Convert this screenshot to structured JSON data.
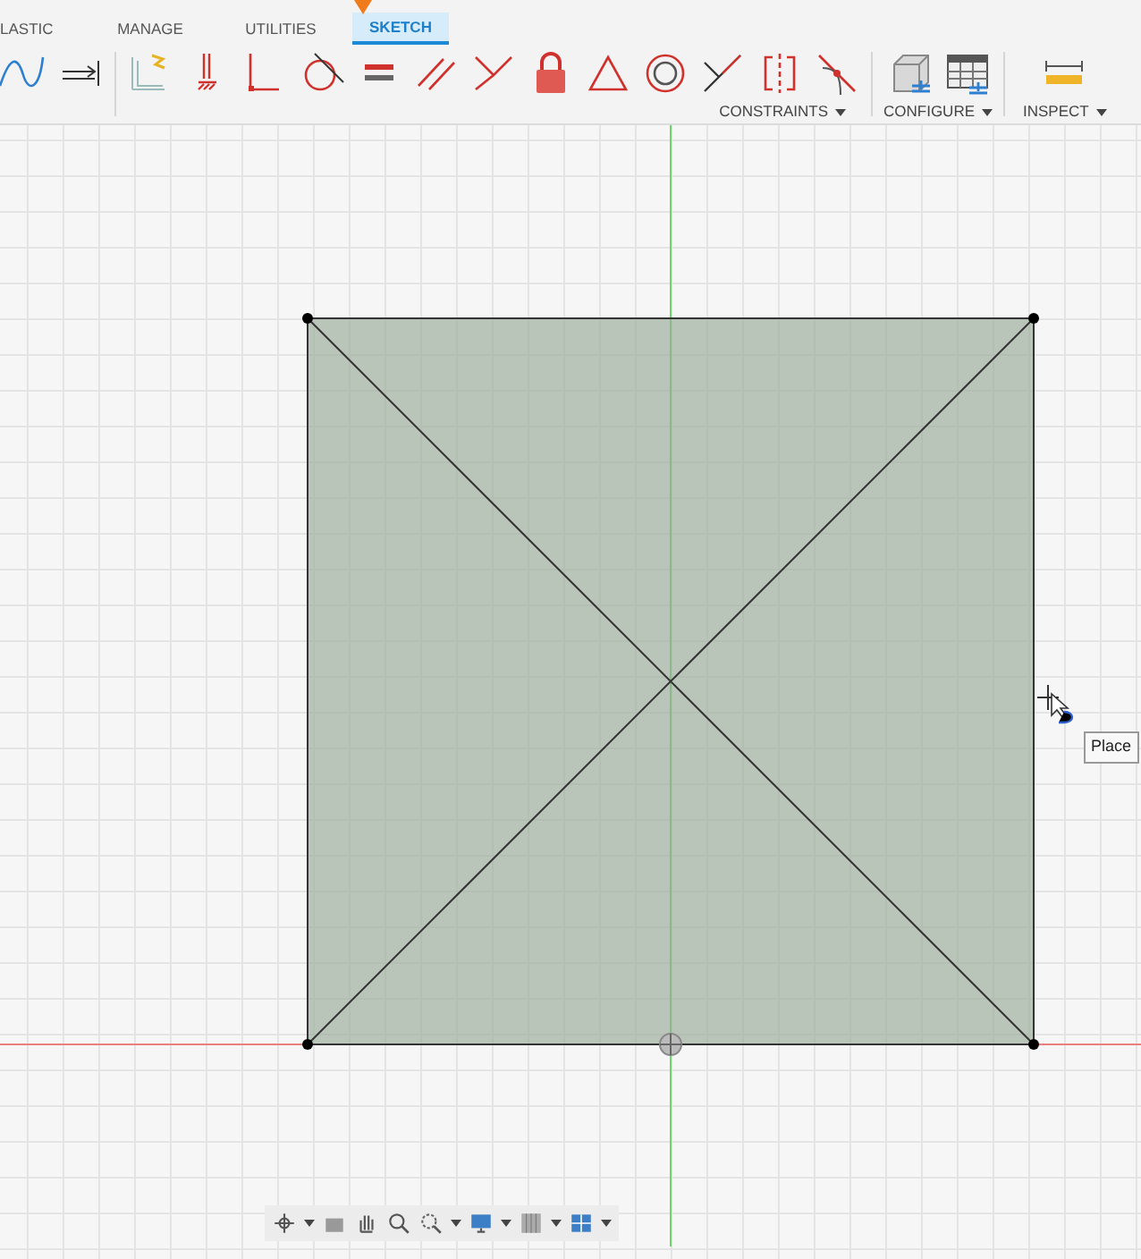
{
  "tabs": [
    {
      "label": "LASTIC",
      "selected": false
    },
    {
      "label": "MANAGE",
      "selected": false
    },
    {
      "label": "UTILITIES",
      "selected": false
    },
    {
      "label": "SKETCH",
      "selected": true
    }
  ],
  "toolbar_groups": [
    {
      "label": "CONSTRAINTS"
    },
    {
      "label": "CONFIGURE"
    },
    {
      "label": "INSPECT"
    }
  ],
  "tooltip": {
    "text": "Place"
  }
}
